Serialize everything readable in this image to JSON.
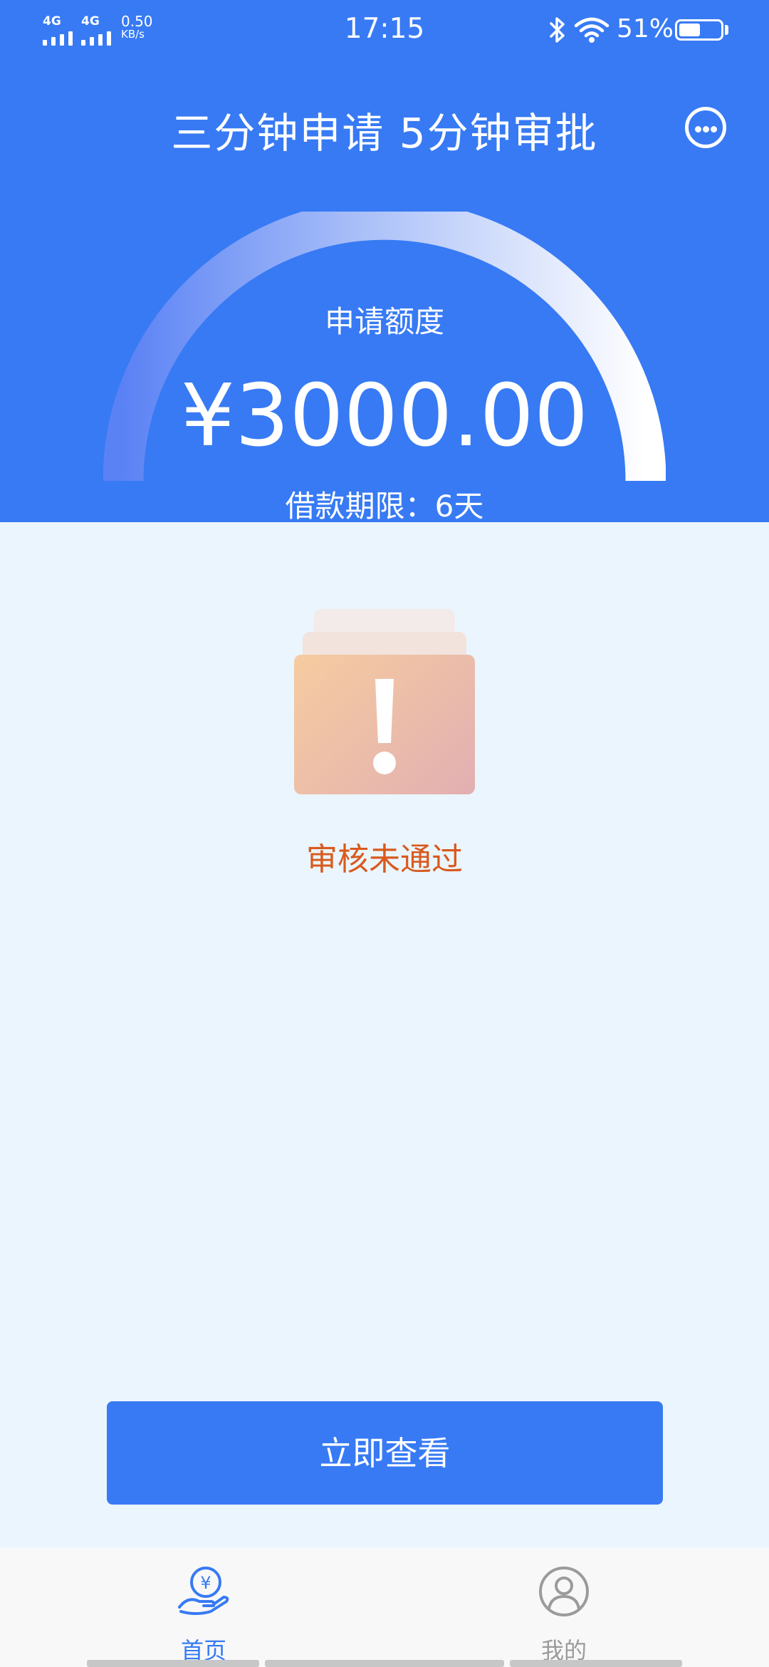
{
  "status_bar": {
    "sim1": "4G",
    "sim2": "4G",
    "net_speed_value": "0.50",
    "net_speed_unit": "KB/s",
    "time": "17:15",
    "battery_percent_label": "51%",
    "battery_level": 0.51
  },
  "header": {
    "title": "三分钟申请 5分钟审批",
    "quota_label": "申请额度",
    "amount": "¥3000.00",
    "loan_term": "借款期限：6天"
  },
  "result": {
    "status_text": "审核未通过"
  },
  "actions": {
    "view_button_label": "立即查看"
  },
  "tabbar": {
    "home_label": "首页",
    "home_icon_glyph": "¥",
    "mine_label": "我的"
  },
  "colors": {
    "primary": "#377af4",
    "page_bg": "#ebf5fd",
    "status_text": "#d85a1f",
    "tab_inactive": "#9b9b9b"
  },
  "icons": [
    "signal-icon",
    "bluetooth-icon",
    "wifi-icon",
    "battery-icon",
    "chat-icon",
    "warning-icon",
    "home-loan-icon",
    "user-icon"
  ]
}
